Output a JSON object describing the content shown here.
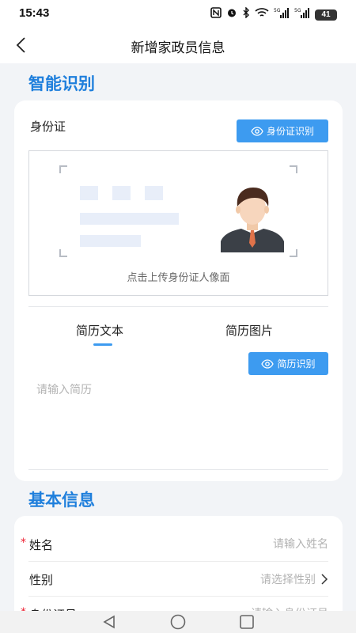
{
  "status": {
    "time": "15:43",
    "battery": "41",
    "signal1": "5G",
    "signal2": "5G"
  },
  "header": {
    "title": "新增家政员信息"
  },
  "smart": {
    "section_title": "智能识别",
    "id_label": "身份证",
    "id_button": "身份证识别",
    "upload_hint": "点击上传身份证人像面",
    "tabs": [
      "简历文本",
      "简历图片"
    ],
    "active_tab": 0,
    "resume_button": "简历识别",
    "resume_placeholder": "请输入简历"
  },
  "basic": {
    "section_title": "基本信息",
    "name_label": "姓名",
    "name_placeholder": "请输入姓名",
    "gender_label": "性别",
    "gender_placeholder": "请选择性别",
    "id_label": "身份证号",
    "id_placeholder": "请输入身份证号"
  },
  "colors": {
    "accent": "#3d9bf0",
    "section_title": "#1f7fdc"
  }
}
